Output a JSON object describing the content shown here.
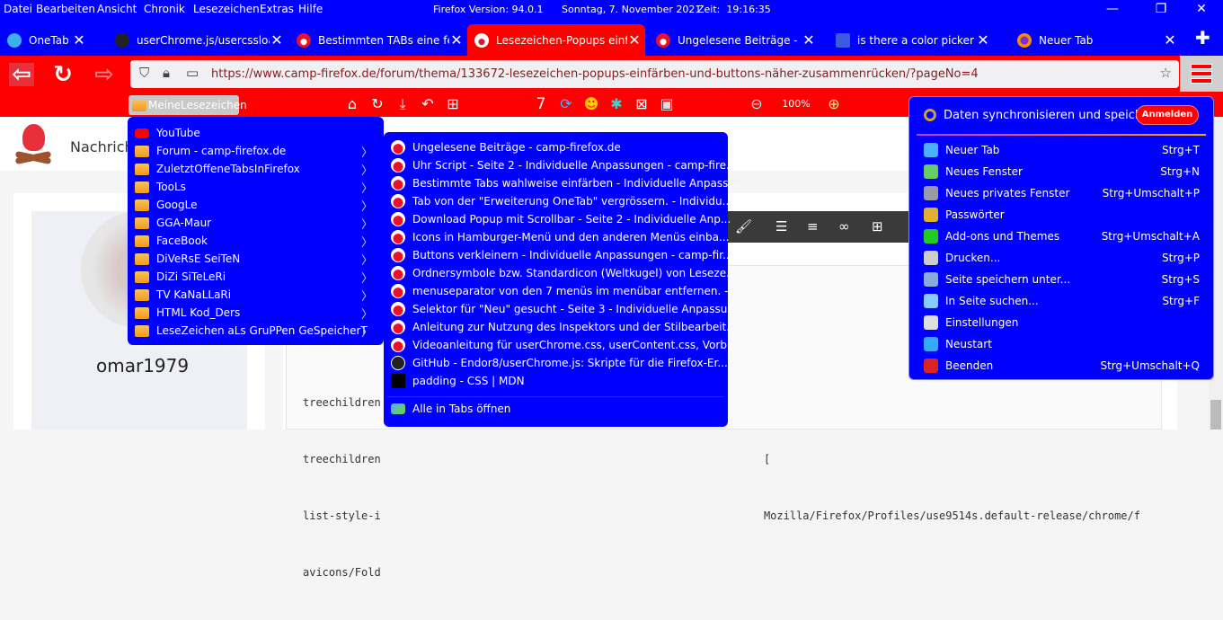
{
  "menubar": {
    "items": [
      "Datei",
      "Bearbeiten",
      "Ansicht",
      "Chronik",
      "Lesezeichen",
      "Extras",
      "Hilfe"
    ],
    "version": "Firefox Version: 94.0.1",
    "date": "Sonntag, 7. November 2021",
    "time": "Zeit:  19:16:35"
  },
  "window_controls": {
    "minimize": "—",
    "restore": "❐",
    "close": "✕"
  },
  "tabs": [
    {
      "title": "OneTab",
      "icon": "onetab-icon"
    },
    {
      "title": "userChrome.js/usercssloader",
      "icon": "github-icon"
    },
    {
      "title": "Bestimmten TABs eine feste Farbe",
      "icon": "camp-firefox-icon"
    },
    {
      "title": "Lesezeichen-Popups einfärben",
      "icon": "camp-firefox-icon",
      "active": true
    },
    {
      "title": "Ungelesene Beiträge - camp-firefox",
      "icon": "camp-firefox-icon"
    },
    {
      "title": "is there a color picker for the",
      "icon": "bb-icon"
    },
    {
      "title": "Neuer Tab",
      "icon": "firefox-icon"
    }
  ],
  "new_tab": "✚",
  "url": "https://www.camp-firefox.de/forum/thema/133672-lesezeichen-popups-einfärben-und-buttons-näher-zusammenrücken/?pageNo=4",
  "bookmarks_toolbar": {
    "folder": "MeineLesezeichen",
    "counter": "7",
    "zoom": "100%"
  },
  "site": {
    "nav_text": "Nachrich",
    "username": "omar1979",
    "code_lines": [
      "treechildren",
      "treechildren                                                           [",
      "list-style-i                                                           Mozilla/Firefox/Profiles/use9514s.default-release/chrome/f",
      "avicons/Fold"
    ]
  },
  "bookmarks_menu": [
    {
      "label": "YouTube",
      "icon": "youtube-icon",
      "folder": false
    },
    {
      "label": "Forum - camp-firefox.de",
      "folder": true
    },
    {
      "label": "ZuletztOffeneTabsInFirefox",
      "folder": true
    },
    {
      "label": "TooLs",
      "folder": true
    },
    {
      "label": "GoogLe",
      "folder": true
    },
    {
      "label": "GGA-Maur",
      "folder": true
    },
    {
      "label": "FaceBook",
      "folder": true
    },
    {
      "label": "DiVeRsE SeiTeN",
      "folder": true
    },
    {
      "label": "DiZi SiTeLeRi",
      "folder": true
    },
    {
      "label": "TV KaNaLLaRi",
      "folder": true
    },
    {
      "label": "HTML Kod_Ders",
      "folder": true
    },
    {
      "label": "LeseZeichen aLs GruPPen GeSpeicherT",
      "folder": true
    }
  ],
  "submenu": {
    "items": [
      {
        "label": "Ungelesene Beiträge - camp-firefox.de",
        "icon": "camp-firefox-icon"
      },
      {
        "label": "Uhr Script - Seite 2 - Individuelle Anpassungen - camp-fire...",
        "icon": "camp-firefox-icon"
      },
      {
        "label": "Bestimmte Tabs wahlweise einfärben - Individuelle Anpass...",
        "icon": "camp-firefox-icon"
      },
      {
        "label": "Tab von der \"Erweiterung OneTab\" vergrössern. - Individu...",
        "icon": "camp-firefox-icon"
      },
      {
        "label": "Download Popup mit Scrollbar - Seite 2 - Individuelle Anp...",
        "icon": "camp-firefox-icon"
      },
      {
        "label": "Icons in Hamburger-Menü und den anderen Menüs einba...",
        "icon": "camp-firefox-icon"
      },
      {
        "label": "Buttons verkleinern - Individuelle Anpassungen - camp-fir...",
        "icon": "camp-firefox-icon"
      },
      {
        "label": "Ordnersymbole bzw. Standardicon (Weltkugel) von Leseze...",
        "icon": "camp-firefox-icon"
      },
      {
        "label": "menuseparator von den 7 menüs im menübar entfernen. -...",
        "icon": "camp-firefox-icon"
      },
      {
        "label": "Selektor für \"Neu\" gesucht - Seite 3 - Individuelle Anpassu...",
        "icon": "camp-firefox-icon"
      },
      {
        "label": "Anleitung zur Nutzung des Inspektors und der Stilbearbeit...",
        "icon": "camp-firefox-icon"
      },
      {
        "label": "Videoanleitung für userChrome.css, userContent.css, Vorb...",
        "icon": "camp-firefox-icon"
      },
      {
        "label": "GitHub - Endor8/userChrome.js: Skripte für die Firefox-Er...",
        "icon": "github-icon"
      },
      {
        "label": "padding - CSS | MDN",
        "icon": "mdn-icon"
      }
    ],
    "open_all": "Alle in Tabs öffnen"
  },
  "app_menu": {
    "sync": "Daten synchronisieren und speichern",
    "signin": "Anmelden",
    "items": [
      {
        "label": "Neuer Tab",
        "shortcut": "Strg+T",
        "icon": "new-tab-icon"
      },
      {
        "label": "Neues Fenster",
        "shortcut": "Strg+N",
        "icon": "new-window-icon"
      },
      {
        "label": "Neues privates Fenster",
        "shortcut": "Strg+Umschalt+P",
        "icon": "private-mask-icon"
      },
      {
        "label": "Passwörter",
        "shortcut": "",
        "icon": "key-icon"
      },
      {
        "label": "Add-ons und Themes",
        "shortcut": "Strg+Umschalt+A",
        "icon": "puzzle-icon"
      },
      {
        "label": "Drucken...",
        "shortcut": "Strg+P",
        "icon": "printer-icon"
      },
      {
        "label": "Seite speichern unter...",
        "shortcut": "Strg+S",
        "icon": "save-page-icon"
      },
      {
        "label": "In Seite suchen...",
        "shortcut": "Strg+F",
        "icon": "magnifier-icon"
      },
      {
        "label": "Einstellungen",
        "shortcut": "",
        "icon": "gear-icon"
      },
      {
        "label": "Neustart",
        "shortcut": "",
        "icon": "restart-icon"
      },
      {
        "label": "Beenden",
        "shortcut": "Strg+Umschalt+Q",
        "icon": "quit-icon"
      }
    ]
  },
  "colors": {
    "chrome_blue": "#0000ff",
    "chrome_red": "#ff0000"
  }
}
